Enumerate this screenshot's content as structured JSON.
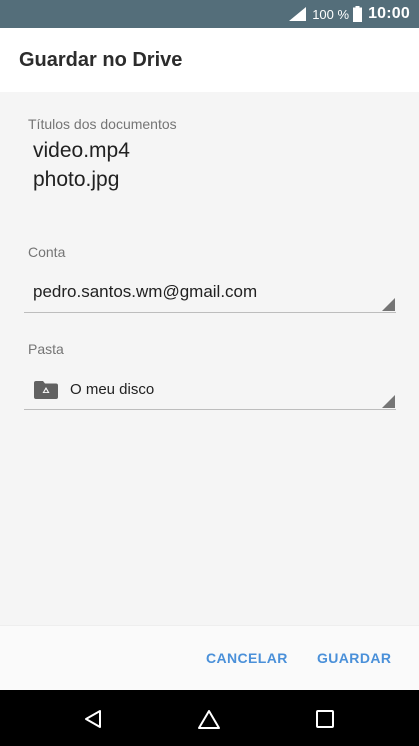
{
  "status_bar": {
    "battery_percent": "100 %",
    "time": "10:00",
    "background_color": "#546e7a",
    "icons": [
      "signal-icon",
      "battery-icon"
    ]
  },
  "dialog": {
    "title": "Guardar no Drive",
    "documents_label": "Títulos dos documentos",
    "documents": [
      "video.mp4",
      "photo.jpg"
    ],
    "account_label": "Conta",
    "account_value": "pedro.santos.wm@gmail.com",
    "folder_label": "Pasta",
    "folder_value": "O meu disco",
    "folder_icon": "drive-folder-icon",
    "buttons": {
      "cancel": "CANCELAR",
      "save": "GUARDAR"
    },
    "accent_color": "#4a90d9"
  },
  "nav_bar": {
    "icons": [
      "back-icon",
      "home-icon",
      "recents-icon"
    ]
  }
}
